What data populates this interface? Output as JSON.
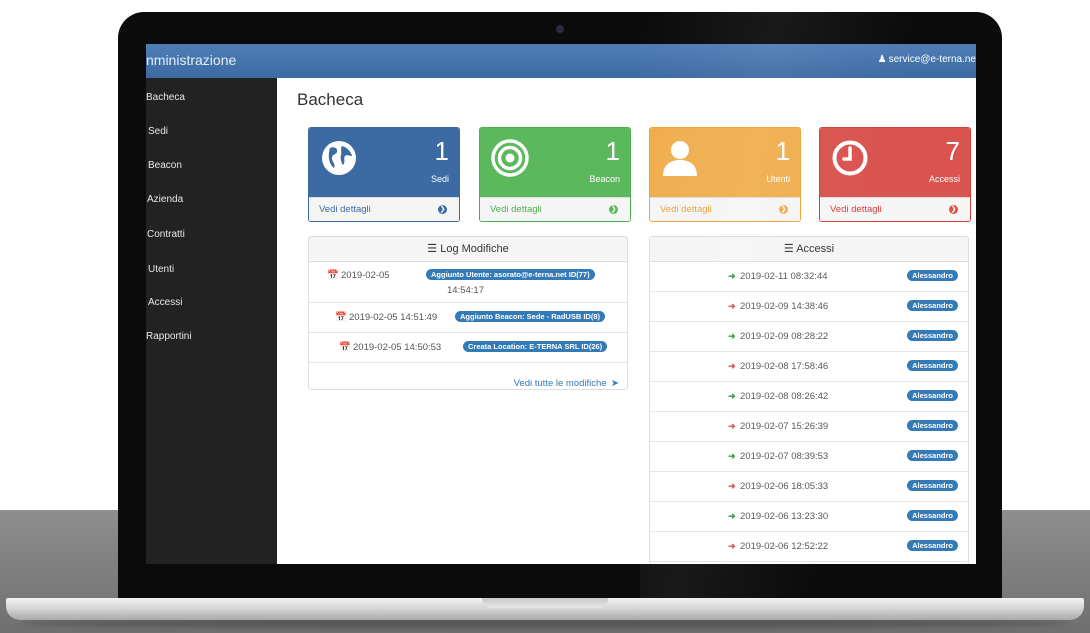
{
  "navbar": {
    "brand": "nministrazione",
    "user": "service@e-terna.ne"
  },
  "sidebar": {
    "items": [
      {
        "label": "Bacheca"
      },
      {
        "label": "Sedi"
      },
      {
        "label": "Beacon"
      },
      {
        "label": "Azienda"
      },
      {
        "label": "Contratti"
      },
      {
        "label": "Utenti"
      },
      {
        "label": "Accessi"
      },
      {
        "label": "Rapportini"
      }
    ]
  },
  "page": {
    "title": "Bacheca"
  },
  "stats": [
    {
      "count": "1",
      "label": "Sedi",
      "footer": "Vedi dettagli",
      "icon": "globe-icon",
      "color": "#3c6aa3"
    },
    {
      "count": "1",
      "label": "Beacon",
      "footer": "Vedi dettagli",
      "icon": "target-icon",
      "color": "#5cb85c"
    },
    {
      "count": "1",
      "label": "Utenti",
      "footer": "Vedi dettagli",
      "icon": "user-icon",
      "color": "#f0ad4e"
    },
    {
      "count": "7",
      "label": "Accessi",
      "footer": "Vedi dettagli",
      "icon": "clock-icon",
      "color": "#d9534f"
    }
  ],
  "log": {
    "title": "Log Modifiche",
    "entries": [
      {
        "date": "2019-02-05",
        "time": "14:54:17",
        "badge": "Aggiunto Utente: asorato@e-terna.net ID(77)"
      },
      {
        "date": "2019-02-05 14:51:49",
        "badge": "Aggiunto Beacon: Sede - RadUSB ID(8)"
      },
      {
        "date": "2019-02-05 14:50:53",
        "badge": "Creata Location: E-TERNA SRL ID(26)"
      }
    ],
    "more": "Vedi tutte le modifiche"
  },
  "accessi": {
    "title": "Accessi",
    "entries": [
      {
        "datetime": "2019-02-11 08:32:44",
        "type": "in",
        "user": "Alessandro"
      },
      {
        "datetime": "2019-02-09 14:38:46",
        "type": "out",
        "user": "Alessandro"
      },
      {
        "datetime": "2019-02-09 08:28:22",
        "type": "in",
        "user": "Alessandro"
      },
      {
        "datetime": "2019-02-08 17:58:46",
        "type": "out",
        "user": "Alessandro"
      },
      {
        "datetime": "2019-02-08 08:26:42",
        "type": "in",
        "user": "Alessandro"
      },
      {
        "datetime": "2019-02-07 15:26:39",
        "type": "out",
        "user": "Alessandro"
      },
      {
        "datetime": "2019-02-07 08:39:53",
        "type": "in",
        "user": "Alessandro"
      },
      {
        "datetime": "2019-02-06 18:05:33",
        "type": "out",
        "user": "Alessandro"
      },
      {
        "datetime": "2019-02-06 13:23:30",
        "type": "in",
        "user": "Alessandro"
      },
      {
        "datetime": "2019-02-06 12:52:22",
        "type": "out",
        "user": "Alessandro"
      }
    ]
  }
}
